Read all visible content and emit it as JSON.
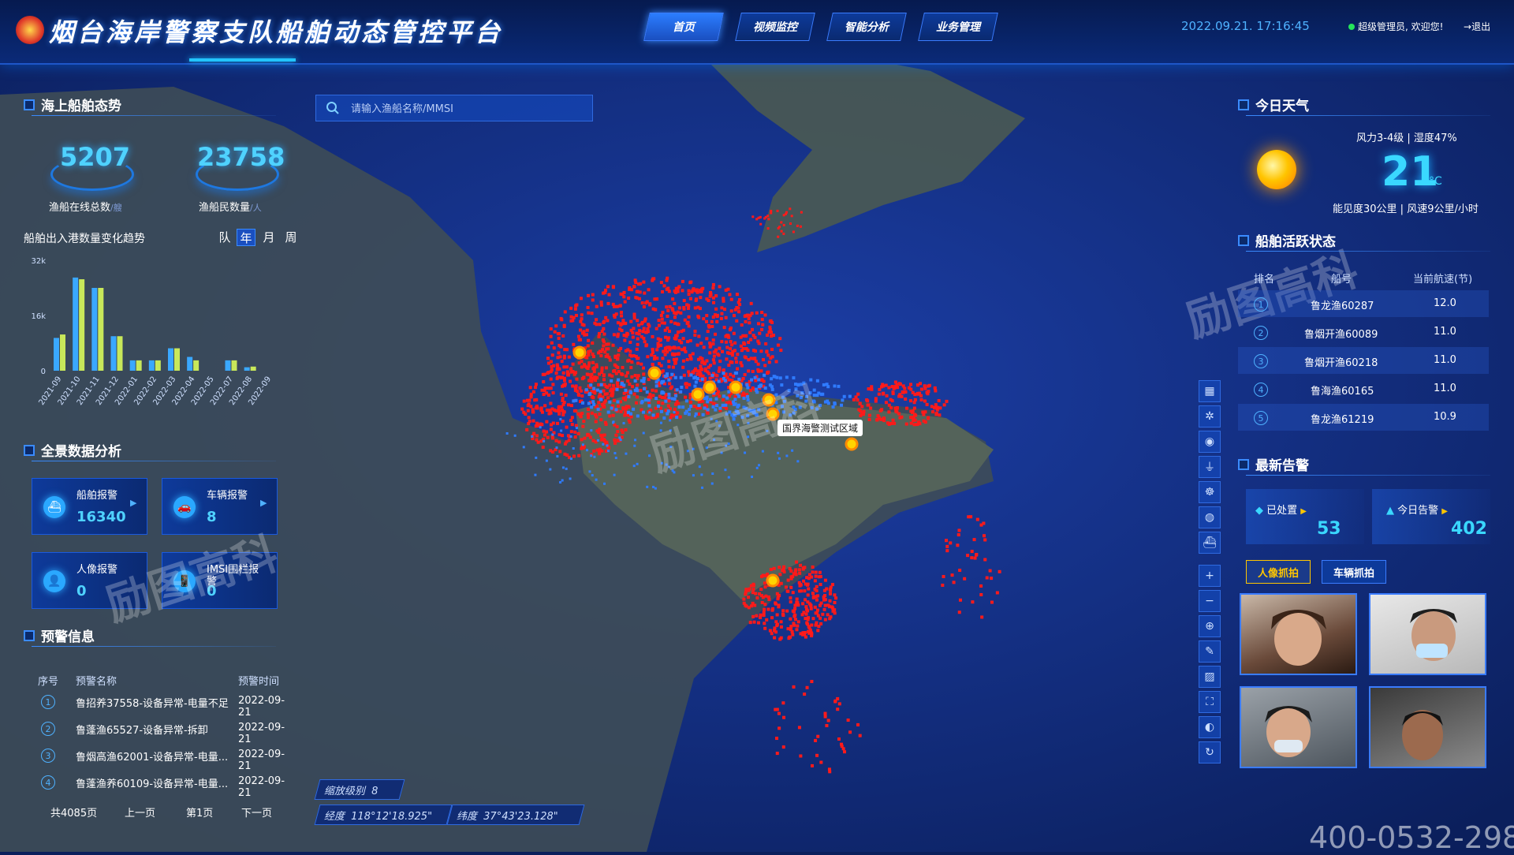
{
  "header": {
    "title": "烟台海岸警察支队船舶动态管控平台",
    "nav": [
      "首页",
      "视频监控",
      "智能分析",
      "业务管理"
    ],
    "active_nav": "首页",
    "datetime": "2022.09.21. 17:16:45",
    "welcome": "超级管理员, 欢迎您!",
    "logout": "退出"
  },
  "search": {
    "placeholder": "请输入渔船名称/MMSI"
  },
  "left": {
    "situation_title": "海上船舶态势",
    "online_count": "5207",
    "online_label": "渔船在线总数",
    "online_unit": "/艘",
    "fishermen_count": "23758",
    "fishermen_label": "渔船民数量",
    "fishermen_unit": "/人",
    "trend_title": "船舶出入港数量变化趋势",
    "periods": [
      "队",
      "年",
      "月",
      "周"
    ],
    "analysis_title": "全景数据分析",
    "alarms": [
      {
        "label": "船舶报警",
        "value": "16340"
      },
      {
        "label": "车辆报警",
        "value": "8"
      },
      {
        "label": "人像报警",
        "value": "0"
      },
      {
        "label": "IMSI围栏报警",
        "value": "0"
      }
    ],
    "warning_title": "预警信息",
    "warning_cols": [
      "序号",
      "预警名称",
      "预警时间"
    ],
    "warnings": [
      {
        "no": "1",
        "name": "鲁招养37558-设备异常-电量不足",
        "time": "2022-09-21"
      },
      {
        "no": "2",
        "name": "鲁蓬渔65527-设备异常-拆卸",
        "time": "2022-09-21"
      },
      {
        "no": "3",
        "name": "鲁烟高渔62001-设备异常-电量...",
        "time": "2022-09-21"
      },
      {
        "no": "4",
        "name": "鲁蓬渔养60109-设备异常-电量...",
        "time": "2022-09-21"
      }
    ],
    "pager": {
      "total": "共4085页",
      "prev": "上一页",
      "current": "第1页",
      "next": "下一页"
    }
  },
  "chart_data": {
    "type": "bar",
    "categories": [
      "2021-09",
      "2021-10",
      "2021-11",
      "2021-12",
      "2022-01",
      "2022-02",
      "2022-03",
      "2022-04",
      "2022-05",
      "2022-07",
      "2022-08",
      "2022-09"
    ],
    "yticks": [
      "32k",
      "16k",
      "0"
    ],
    "ylim": [
      0,
      32000
    ],
    "series": [
      {
        "color": "#3aa8ff",
        "values": [
          9500,
          27000,
          24000,
          10000,
          3000,
          3000,
          6500,
          4000,
          0,
          3000,
          1000,
          0
        ]
      },
      {
        "color": "#c8e85a",
        "values": [
          10500,
          26500,
          24000,
          10000,
          3000,
          3000,
          6500,
          3000,
          0,
          3000,
          1200,
          0
        ]
      }
    ]
  },
  "map": {
    "label": "国界海警测试区域",
    "zoom_label": "缩放级别",
    "zoom_value": "8",
    "lon_label": "经度",
    "lon_value": "118°12'18.925\"",
    "lat_label": "纬度",
    "lat_value": "37°43'23.128\"",
    "watermark": "励图高科",
    "phone": "400-0532-298"
  },
  "weather": {
    "title": "今日天气",
    "wind": "风力3-4级",
    "humidity": "湿度47%",
    "temp": "21",
    "unit": "°C",
    "visibility": "能见度30公里",
    "wind_speed": "风速9公里/小时"
  },
  "activity": {
    "title": "船舶活跃状态",
    "cols": [
      "排名",
      "船号",
      "当前航速(节)"
    ],
    "rows": [
      {
        "rank": "1",
        "ship": "鲁龙渔60287",
        "speed": "12.0"
      },
      {
        "rank": "2",
        "ship": "鲁烟开渔60089",
        "speed": "11.0"
      },
      {
        "rank": "3",
        "ship": "鲁烟开渔60218",
        "speed": "11.0"
      },
      {
        "rank": "4",
        "ship": "鲁海渔60165",
        "speed": "11.0"
      },
      {
        "rank": "5",
        "ship": "鲁龙渔61219",
        "speed": "10.9"
      }
    ]
  },
  "alerts": {
    "title": "最新告警",
    "handled_label": "已处置",
    "handled_value": "53",
    "today_label": "今日告警",
    "today_value": "402",
    "tabs": [
      "人像抓拍",
      "车辆抓拍"
    ]
  }
}
